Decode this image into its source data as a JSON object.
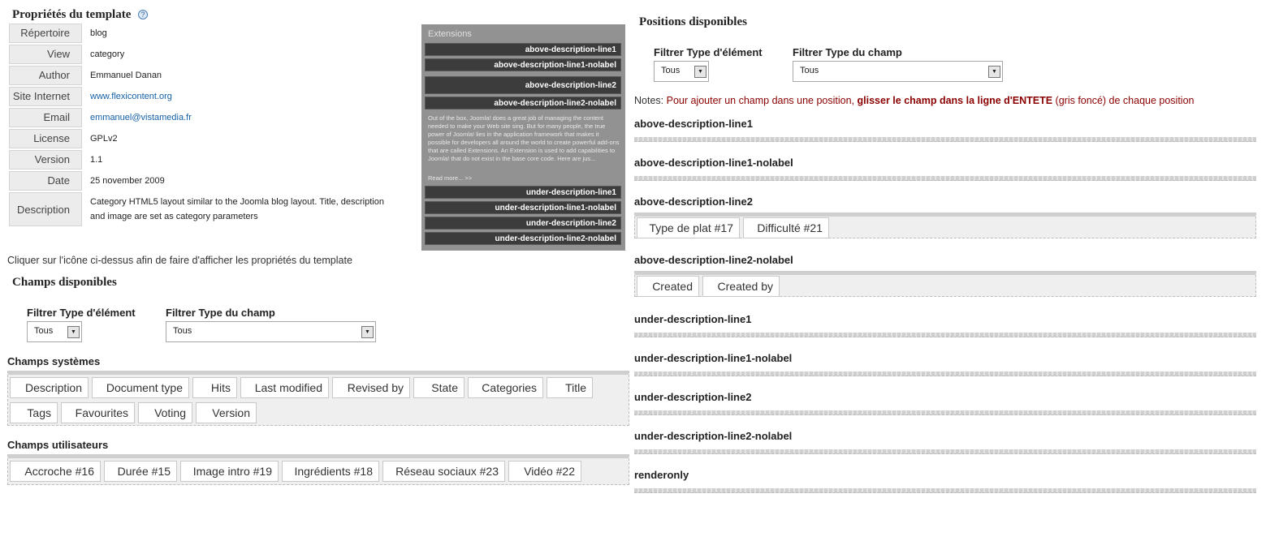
{
  "template_props": {
    "title": "Propriétés du template",
    "rows": [
      {
        "label": "Répertoire",
        "value": "blog"
      },
      {
        "label": "View",
        "value": "category"
      },
      {
        "label": "Author",
        "value": "Emmanuel Danan"
      },
      {
        "label": "Site Internet",
        "value": "www.flexicontent.org"
      },
      {
        "label": "Email",
        "value": "emmanuel@vistamedia.fr"
      },
      {
        "label": "License",
        "value": "GPLv2"
      },
      {
        "label": "Version",
        "value": "1.1"
      },
      {
        "label": "Date",
        "value": "25 november 2009"
      },
      {
        "label": "Description",
        "value": "Category HTML5 layout similar to the Joomla blog layout. Title, description and image are set as category parameters"
      }
    ],
    "click_note": "Cliquer sur l'icône ci-dessus afin de faire d'afficher les propriétés du template"
  },
  "preview": {
    "title": "Extensions",
    "bars_top": [
      "above-description-line1",
      "above-description-line1-nolabel",
      "above-description-line2",
      "above-description-line2-nolabel"
    ],
    "text": "Out of the box, Joomla! does a great job of managing the content needed to make your Web site sing. But for many people, the true power of Joomla! lies in the application framework that makes it possible for developers all around the world to create powerful add-ons that are called Extensions. An Extension is used to add capabilities to Joomla! that do not exist in the base core code. Here are jus...",
    "read_more": "Read more... >>",
    "bars_bottom": [
      "under-description-line1",
      "under-description-line1-nolabel",
      "under-description-line2",
      "under-description-line2-nolabel"
    ]
  },
  "available": {
    "title": "Champs disponibles",
    "filter_type_label": "Filtrer Type d'élément",
    "filter_type_value": "Tous",
    "filter_field_label": "Filtrer Type du champ",
    "filter_field_value": "Tous",
    "system_label": "Champs systèmes",
    "system_fields": [
      "Description",
      "Document type",
      "Hits",
      "Last modified",
      "Revised by",
      "State",
      "Categories",
      "Title",
      "Tags",
      "Favourites",
      "Voting",
      "Version"
    ],
    "user_label": "Champs utilisateurs",
    "user_fields": [
      "Accroche #16",
      "Durée #15",
      "Image intro #19",
      "Ingrédients #18",
      "Réseau sociaux #23",
      "Vidéo #22"
    ]
  },
  "positions": {
    "title": "Positions disponibles",
    "filter_type_label": "Filtrer Type d'élément",
    "filter_type_value": "Tous",
    "filter_field_label": "Filtrer Type du champ",
    "filter_field_value": "Tous",
    "notes_label": "Notes:",
    "notes_a": "Pour ajouter un champ dans une position,",
    "notes_b": "glisser le champ dans la ligne d'ENTETE",
    "notes_c": "(gris foncé) de chaque position",
    "items": [
      {
        "name": "above-description-line1",
        "fields": []
      },
      {
        "name": "above-description-line1-nolabel",
        "fields": []
      },
      {
        "name": "above-description-line2",
        "fields": [
          "Type de plat #17",
          "Difficulté #21"
        ]
      },
      {
        "name": "above-description-line2-nolabel",
        "fields": [
          "Created",
          "Created by"
        ]
      },
      {
        "name": "under-description-line1",
        "fields": []
      },
      {
        "name": "under-description-line1-nolabel",
        "fields": []
      },
      {
        "name": "under-description-line2",
        "fields": []
      },
      {
        "name": "under-description-line2-nolabel",
        "fields": []
      },
      {
        "name": "renderonly",
        "fields": []
      }
    ]
  },
  "icons": {
    "help": "help-icon",
    "dropdown": "chevron-down-icon"
  }
}
